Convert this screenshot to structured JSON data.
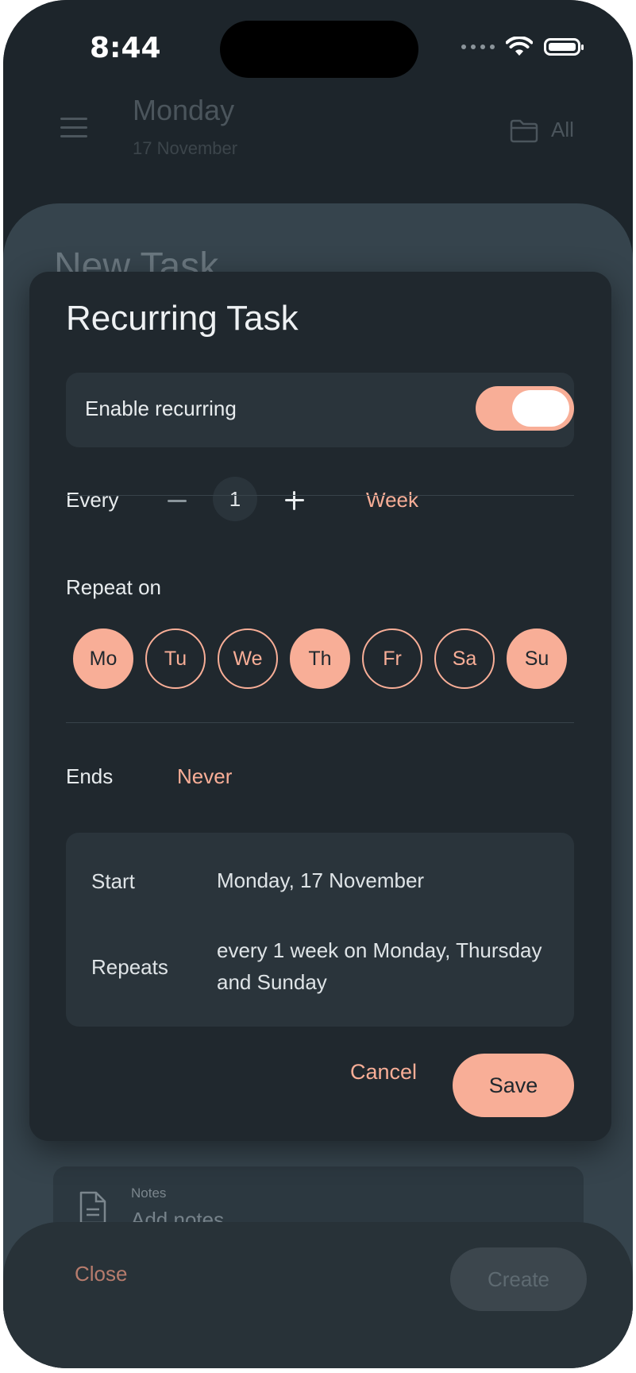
{
  "status_bar": {
    "time": "8:44"
  },
  "background_app": {
    "title": "Monday",
    "subtitle": "17 November",
    "folder_label": "All"
  },
  "new_task_sheet": {
    "title": "New Task",
    "notes_label": "Notes",
    "notes_placeholder": "Add notes",
    "close_label": "Close",
    "create_label": "Create"
  },
  "dialog": {
    "title": "Recurring Task",
    "enable_label": "Enable recurring",
    "enabled": true,
    "every_label": "Every",
    "interval": "1",
    "unit": "Week",
    "repeat_on_label": "Repeat on",
    "days": [
      {
        "label": "Mo",
        "selected": true
      },
      {
        "label": "Tu",
        "selected": false
      },
      {
        "label": "We",
        "selected": false
      },
      {
        "label": "Th",
        "selected": true
      },
      {
        "label": "Fr",
        "selected": false
      },
      {
        "label": "Sa",
        "selected": false
      },
      {
        "label": "Su",
        "selected": true
      }
    ],
    "ends_label": "Ends",
    "ends_value": "Never",
    "summary": {
      "start_key": "Start",
      "start_value": "Monday, 17 November",
      "repeats_key": "Repeats",
      "repeats_value": "every 1 week on Monday, Thursday and Sunday"
    },
    "cancel_label": "Cancel",
    "save_label": "Save"
  },
  "colors": {
    "accent": "#f8ae97",
    "dialog_bg": "#20282e",
    "card_bg": "#2a343b",
    "sheet_bg": "#36444d"
  },
  "icons": [
    "wifi-icon",
    "battery-icon",
    "menu-icon",
    "folder-icon",
    "notes-icon",
    "minus-icon",
    "plus-icon"
  ]
}
